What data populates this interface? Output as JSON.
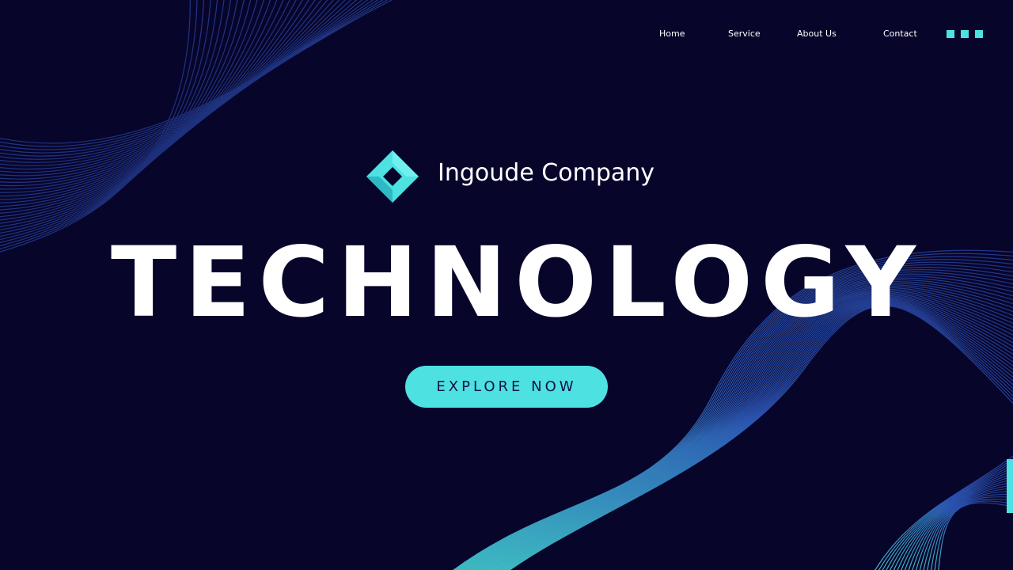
{
  "nav": {
    "items": [
      {
        "label": "Home"
      },
      {
        "label": "Service"
      },
      {
        "label": "About Us"
      },
      {
        "label": "Contact"
      }
    ],
    "menu_icon": "menu-dots-icon"
  },
  "brand": {
    "name": "Ingoude Company",
    "logo_icon": "diamond-logo-icon"
  },
  "hero": {
    "headline": "TECHNOLOGY",
    "cta_label": "EXPLORE NOW"
  },
  "colors": {
    "background": "#08052b",
    "accent": "#4de1e1",
    "text": "#ffffff",
    "wave": "#3a5bbf"
  }
}
